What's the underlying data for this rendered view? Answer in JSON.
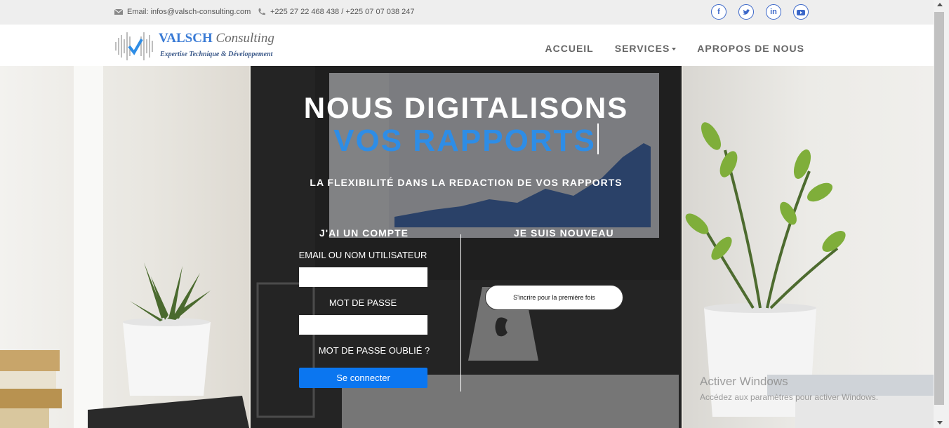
{
  "topbar": {
    "email": "Email: infos@valsch-consulting.com",
    "phone": "+225 27 22 468 438 / +225 07 07 038 247",
    "socials": [
      {
        "name": "facebook-icon",
        "glyph": "f"
      },
      {
        "name": "twitter-icon",
        "glyph": "t"
      },
      {
        "name": "linkedin-icon",
        "glyph": "in"
      },
      {
        "name": "youtube-icon",
        "glyph": "▶"
      }
    ]
  },
  "brand": {
    "name_bold": "VALSCH",
    "name_script": "Consulting",
    "tagline": "Expertise Technique & Développement"
  },
  "nav": {
    "items": [
      {
        "label": "ACCUEIL"
      },
      {
        "label": "SERVICES"
      },
      {
        "label": "APROPOS DE NOUS"
      }
    ]
  },
  "hero": {
    "headline_line1": "NOUS DIGITALISONS",
    "headline_line2": "VOS RAPPORTS",
    "tagline": "LA FLEXIBILITÉ DANS LA REDACTION DE VOS RAPPORTS"
  },
  "login": {
    "title": "J'AI UN COMPTE",
    "email_label": "EMAIL OU NOM UTILISATEUR",
    "email_value": "",
    "password_label": "MOT DE PASSE",
    "password_value": "",
    "forgot": "MOT DE PASSE OUBLIÉ ?",
    "submit": "Se connecter"
  },
  "signup": {
    "title": "JE SUIS NOUVEAU",
    "button": "S'incrire pour la première fois"
  },
  "watermark": {
    "line1": "Activer Windows",
    "line2": "Accédez aux paramètres pour activer Windows."
  },
  "colors": {
    "accent_blue": "#2e8de6",
    "button_blue": "#0b76f0",
    "social_blue": "#3b67c9"
  }
}
